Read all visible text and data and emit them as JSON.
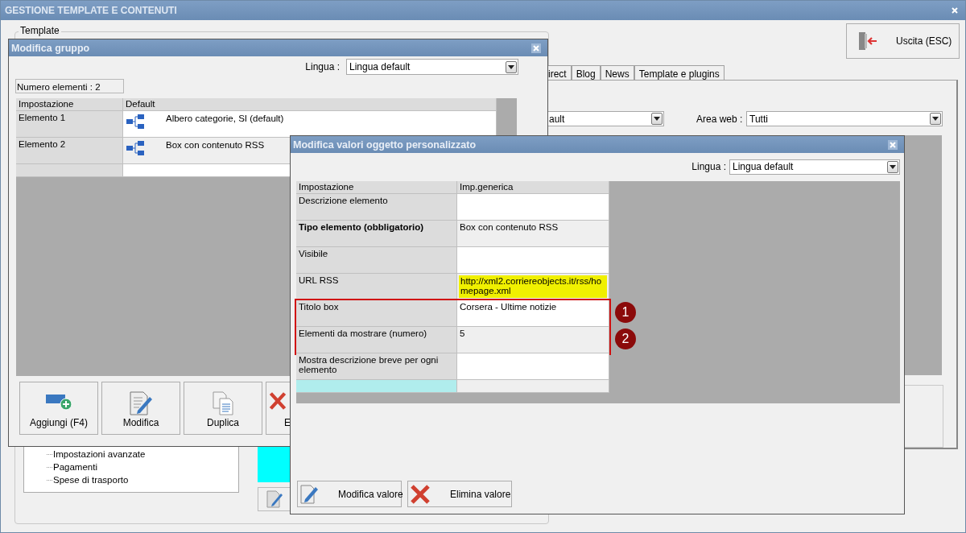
{
  "window": {
    "title": "GESTIONE TEMPLATE E CONTENUTI"
  },
  "template_group": {
    "label": "Template"
  },
  "exit_button": {
    "label": "Uscita (ESC)"
  },
  "tabs": [
    {
      "label": "irect",
      "selected": false
    },
    {
      "label": "Blog",
      "selected": false
    },
    {
      "label": "News",
      "selected": false
    },
    {
      "label": "Template e plugins",
      "selected": false
    }
  ],
  "language_combo": {
    "value": "ault"
  },
  "area_web": {
    "label": "Area web :",
    "value": "Tutti"
  },
  "tree": {
    "items": [
      "Impostazioni avanzate",
      "Pagamenti",
      "Spese di trasporto"
    ]
  },
  "group_dialog": {
    "title": "Modifica gruppo",
    "language": {
      "label": "Lingua :",
      "value": "Lingua default"
    },
    "count": "Numero elementi : 2",
    "columns": [
      "Impostazione",
      "Default"
    ],
    "rows": [
      {
        "name": "Elemento 1",
        "value": "Albero categorie, SI (default)"
      },
      {
        "name": "Elemento 2",
        "value": "Box con contenuto RSS"
      }
    ],
    "buttons": [
      {
        "label": "Aggiungi (F4)",
        "kind": "add"
      },
      {
        "label": "Modifica",
        "kind": "edit"
      },
      {
        "label": "Duplica",
        "kind": "copy"
      },
      {
        "label": "E",
        "kind": "delete"
      }
    ]
  },
  "object_dialog": {
    "title": "Modifica valori oggetto personalizzato",
    "language": {
      "label": "Lingua :",
      "value": "Lingua default"
    },
    "columns": [
      "Impostazione",
      "Imp.generica"
    ],
    "rows": [
      {
        "name": "Descrizione elemento",
        "selected": false
      },
      {
        "name": "Tipo elemento (obbligatorio)",
        "value": "Box con contenuto RSS",
        "required": true,
        "selected": false
      },
      {
        "name": "Visibile",
        "selected": false
      },
      {
        "name": "URL RSS",
        "value": "http://xml2.corriereobjects.it/rss/homepage.xml",
        "highlighted": true,
        "selected": false
      },
      {
        "name": "Titolo box",
        "value": "Corsera - Ultime notizie",
        "callout": "1",
        "selected": false
      },
      {
        "name": "Elementi da mostrare (numero)",
        "value": "5",
        "callout": "2",
        "selected": false
      },
      {
        "name": "Mostra descrizione breve per ogni elemento",
        "selected": false
      },
      {
        "selected": true
      }
    ],
    "buttons": [
      {
        "label": "Modifica valore",
        "kind": "edit"
      },
      {
        "label": "Elimina valore",
        "kind": "delete"
      }
    ]
  }
}
